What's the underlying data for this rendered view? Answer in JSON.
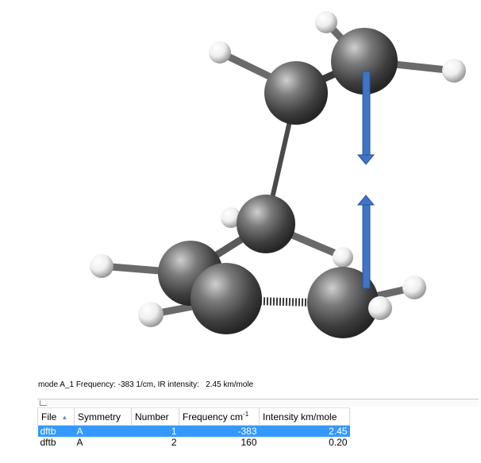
{
  "viewer": {
    "description_icon": "molecule-3d-view",
    "colors": {
      "carbon": "#5a5a5a",
      "hydrogen": "#f2f2f2",
      "vector": "#3f74c6"
    }
  },
  "mode_line": "mode A_1 Frequency: -383 1/cm, IR intensity:   2.45 km/mole",
  "table": {
    "headers": {
      "file": "File",
      "symmetry": "Symmetry",
      "number": "Number",
      "frequency": "Frequency cm",
      "frequency_sup": "-1",
      "intensity": "Intensity km/mole"
    },
    "sort_icon": "sort-ascending-icon",
    "rows": [
      {
        "file": "dftb",
        "symmetry": "A",
        "number": "1",
        "frequency": "-383",
        "intensity": "2.45"
      },
      {
        "file": "dftb",
        "symmetry": "A",
        "number": "2",
        "frequency": "160",
        "intensity": "0.20"
      }
    ],
    "selected_row": 0
  }
}
